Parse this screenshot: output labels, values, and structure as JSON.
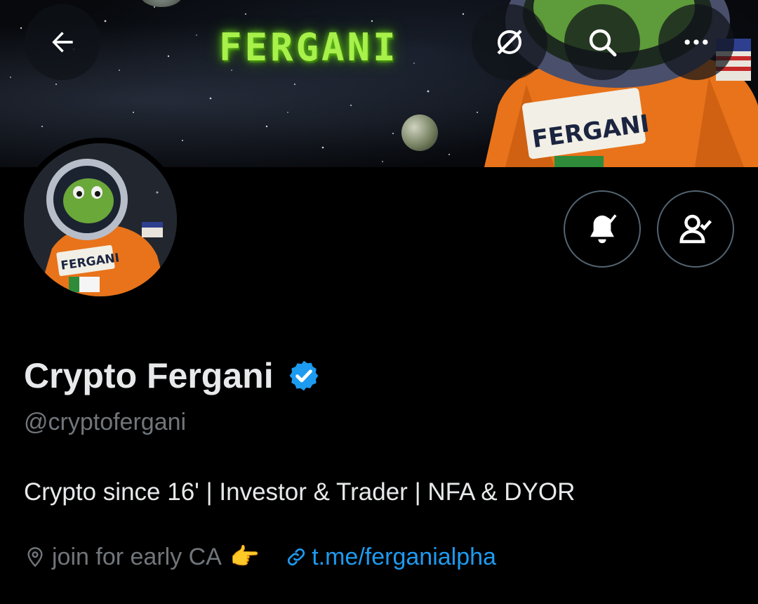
{
  "header": {
    "banner_text": "FERGANI",
    "buttons": [
      {
        "name": "back",
        "icon": "arrow-left-icon"
      },
      {
        "name": "grok",
        "icon": "grok-icon"
      },
      {
        "name": "search",
        "icon": "search-icon"
      },
      {
        "name": "more",
        "icon": "more-icon"
      }
    ]
  },
  "profile": {
    "display_name": "Crypto Fergani",
    "verified": true,
    "handle": "@cryptofergani",
    "bio": "Crypto since 16' | Investor & Trader | NFA & DYOR",
    "location": "join for early CA",
    "location_emoji": "👉",
    "link": "t.me/ferganialpha"
  },
  "actions": [
    {
      "name": "notifications",
      "icon": "bell-check-icon"
    },
    {
      "name": "following",
      "icon": "person-check-icon"
    }
  ],
  "colors": {
    "background": "#000000",
    "text": "#e7e9ea",
    "secondary": "#71767b",
    "accent": "#1d9bf0",
    "border": "#536471"
  }
}
